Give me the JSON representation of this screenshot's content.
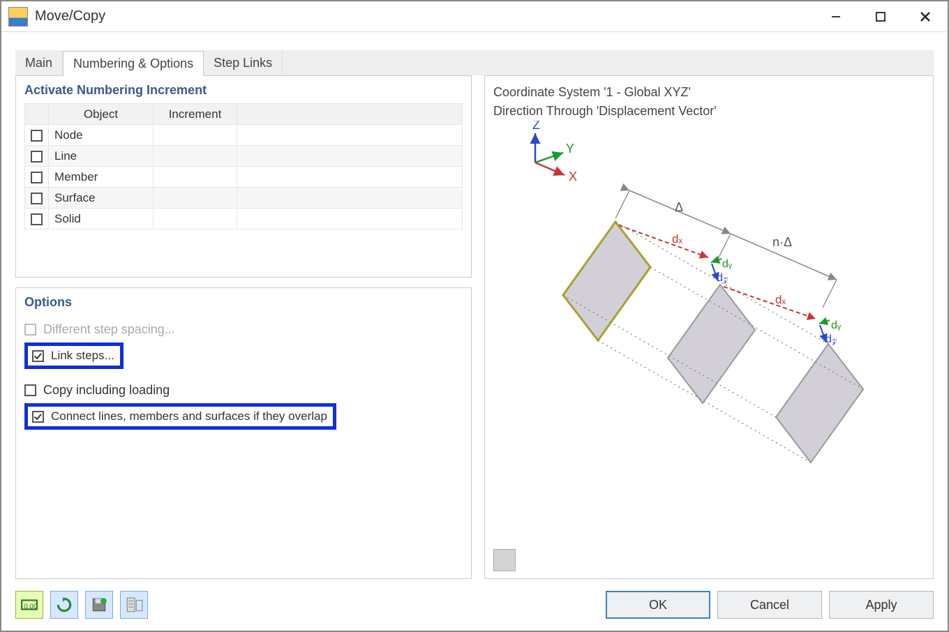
{
  "window": {
    "title": "Move/Copy"
  },
  "tabs": {
    "main": "Main",
    "numbering": "Numbering & Options",
    "steplinks": "Step Links"
  },
  "numbering": {
    "header": "Activate Numbering Increment",
    "col_object": "Object",
    "col_increment": "Increment",
    "rows": {
      "node": "Node",
      "line": "Line",
      "member": "Member",
      "surface": "Surface",
      "solid": "Solid"
    }
  },
  "options": {
    "header": "Options",
    "diff_spacing": "Different step spacing...",
    "link_steps": "Link steps...",
    "copy_loading": "Copy including loading",
    "connect_overlap": "Connect lines, members and surfaces if they overlap"
  },
  "preview": {
    "line1": "Coordinate System '1 - Global XYZ'",
    "line2": "Direction Through 'Displacement Vector'",
    "axis": {
      "z": "Z",
      "y": "Y",
      "x": "X"
    },
    "labels": {
      "delta": "Δ",
      "ndelta": "n·Δ",
      "dx": "dₓ",
      "dy": "dᵧ",
      "dz": "d𝓏"
    }
  },
  "buttons": {
    "ok": "OK",
    "cancel": "Cancel",
    "apply": "Apply"
  }
}
